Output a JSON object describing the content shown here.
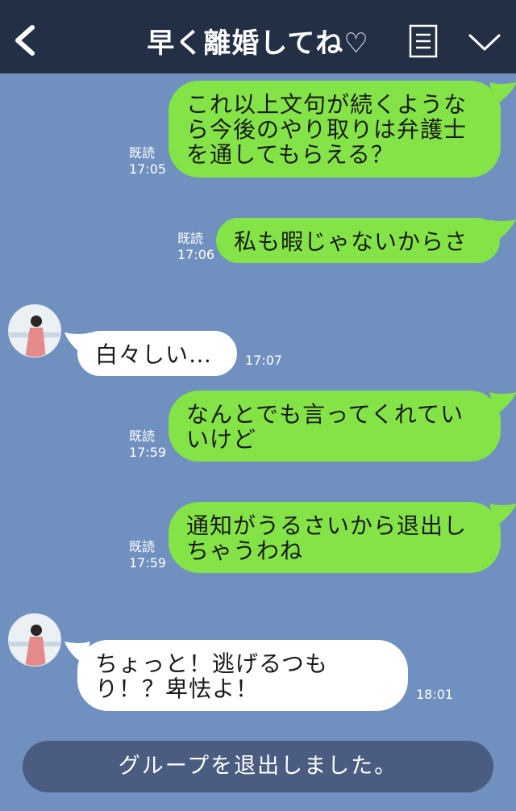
{
  "header": {
    "title": "早く離婚してね♡"
  },
  "messages": [
    {
      "side": "sent",
      "text_line1": "これ以上文句が続くようなら今後のやり取りは弁護士を通してもらえる？",
      "read": "既読",
      "time": "17:05"
    },
    {
      "side": "sent",
      "text": "私も暇じゃないからさ",
      "read": "既読",
      "time": "17:06"
    },
    {
      "side": "received",
      "text": "白々しい…",
      "time": "17:07"
    },
    {
      "side": "sent",
      "text": "なんとでも言ってくれていいけど",
      "read": "既読",
      "time": "17:59"
    },
    {
      "side": "sent",
      "text": "通知がうるさいから退出しちゃうわね",
      "read": "既読",
      "time": "17:59"
    },
    {
      "side": "received",
      "text": "ちょっと！逃げるつもり！？卑怯よ！",
      "time": "18:01"
    }
  ],
  "system_notice": "グループを退出しました。",
  "colors": {
    "header_bg": "#232f45",
    "chat_bg": "#7090c0",
    "sent_bubble": "#84e346",
    "received_bubble": "#ffffff",
    "system_bar": "#4a5d80"
  },
  "icons": [
    "back-arrow-icon",
    "menu-list-icon",
    "chevron-down-icon"
  ]
}
